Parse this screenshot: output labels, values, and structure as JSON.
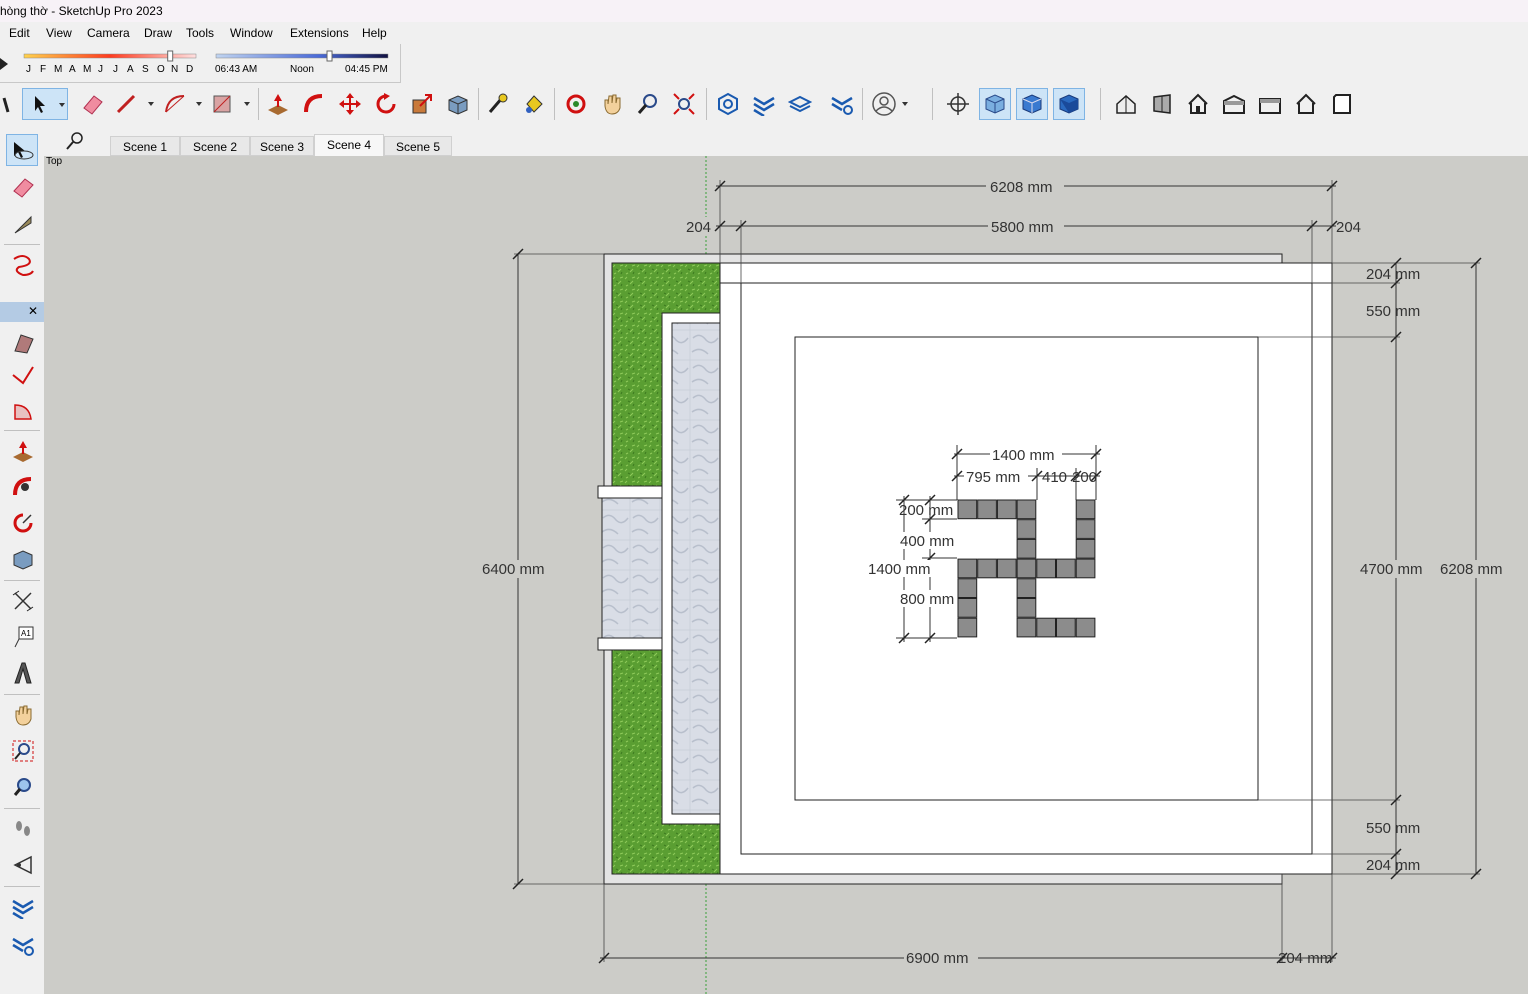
{
  "window": {
    "title": "hòng thờ - SketchUp Pro 2023"
  },
  "menu": [
    "Edit",
    "View",
    "Camera",
    "Draw",
    "Tools",
    "Window",
    "Extensions",
    "Help"
  ],
  "shadows": {
    "months": [
      "J",
      "F",
      "M",
      "A",
      "M",
      "J",
      "J",
      "A",
      "S",
      "O",
      "N",
      "D"
    ],
    "time_start": "06:43 AM",
    "time_mid": "Noon",
    "time_end": "04:45 PM",
    "month_position": 0.85,
    "time_position": 0.66
  },
  "scenes": {
    "tabs": [
      "Scene 1",
      "Scene 2",
      "Scene 3",
      "Scene 4",
      "Scene 5"
    ],
    "active": "Scene 4"
  },
  "viewport": {
    "view_name": "Top"
  },
  "dimensions": {
    "top_total": "6208 mm",
    "top_left": "204",
    "top_inner": "5800 mm",
    "top_right": "204",
    "right_204_top": "204 mm",
    "right_550_top": "550 mm",
    "right_550_bottom": "550 mm",
    "right_204_bottom": "204 mm",
    "right_inner": "4700 mm",
    "right_total": "6208 mm",
    "left_total": "6400 mm",
    "bottom_total": "6900 mm",
    "bottom_right": "204 mm",
    "symbol_width": "1400 mm",
    "symbol_795": "795 mm",
    "symbol_410": "410",
    "symbol_200h": "200",
    "symbol_200v": "200 mm",
    "symbol_400": "400 mm",
    "symbol_height": "1400 mm",
    "symbol_800": "800 mm"
  },
  "colors": {
    "grass": "#5a9e32",
    "tile": "#d9dde6",
    "viewport_bg": "#ccccc8",
    "block": "#8c8c8c"
  }
}
